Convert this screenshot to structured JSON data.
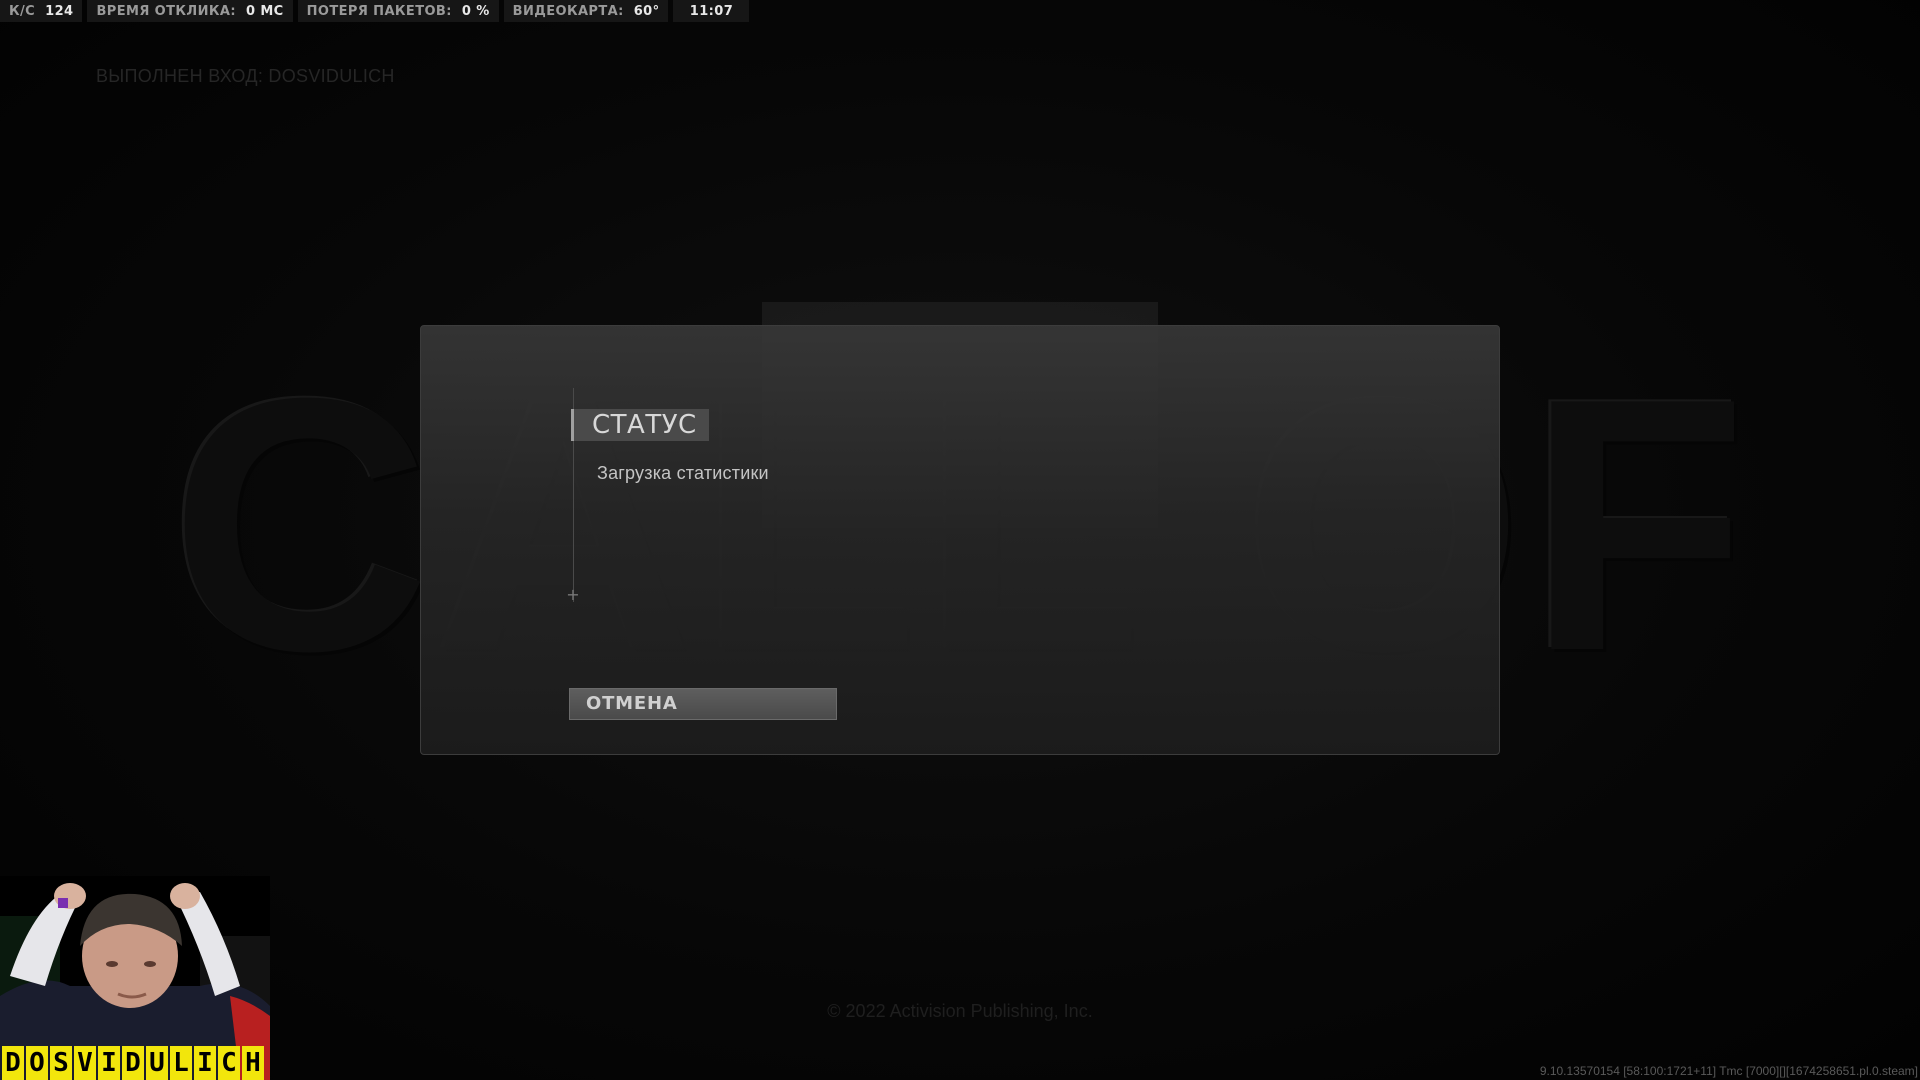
{
  "hud": {
    "fps_label": "К/С",
    "fps_value": "124",
    "latency_label": "ВРЕМЯ ОТКЛИКА:",
    "latency_value": "0 МС",
    "packet_loss_label": "ПОТЕРЯ ПАКЕТОВ:",
    "packet_loss_value": "0 %",
    "gpu_label": "ВИДЕОКАРТА:",
    "gpu_value": "60°",
    "clock": "11:07"
  },
  "login_status": "ВЫПОЛНЕН ВХОД: DOSVIDULICH",
  "background_logo": "CALL OF DUTY",
  "dialog": {
    "title": "СТАТУС",
    "message": "Загрузка статистики",
    "cancel_label": "ОТМЕНА"
  },
  "footer": {
    "copyright": "© 2022 Activision Publishing, Inc.",
    "version": "9.10.13570154 [58:100:1721+11] Tmc [7000][][1674258651.pl.0.steam]"
  },
  "webcam": {
    "streamer_letters": [
      "D",
      "O",
      "S",
      "V",
      "I",
      "D",
      "U",
      "L",
      "I",
      "C",
      "H"
    ]
  },
  "colors": {
    "name_plate": "#f2e60c",
    "dialog_bg": "#2c2c2c"
  }
}
